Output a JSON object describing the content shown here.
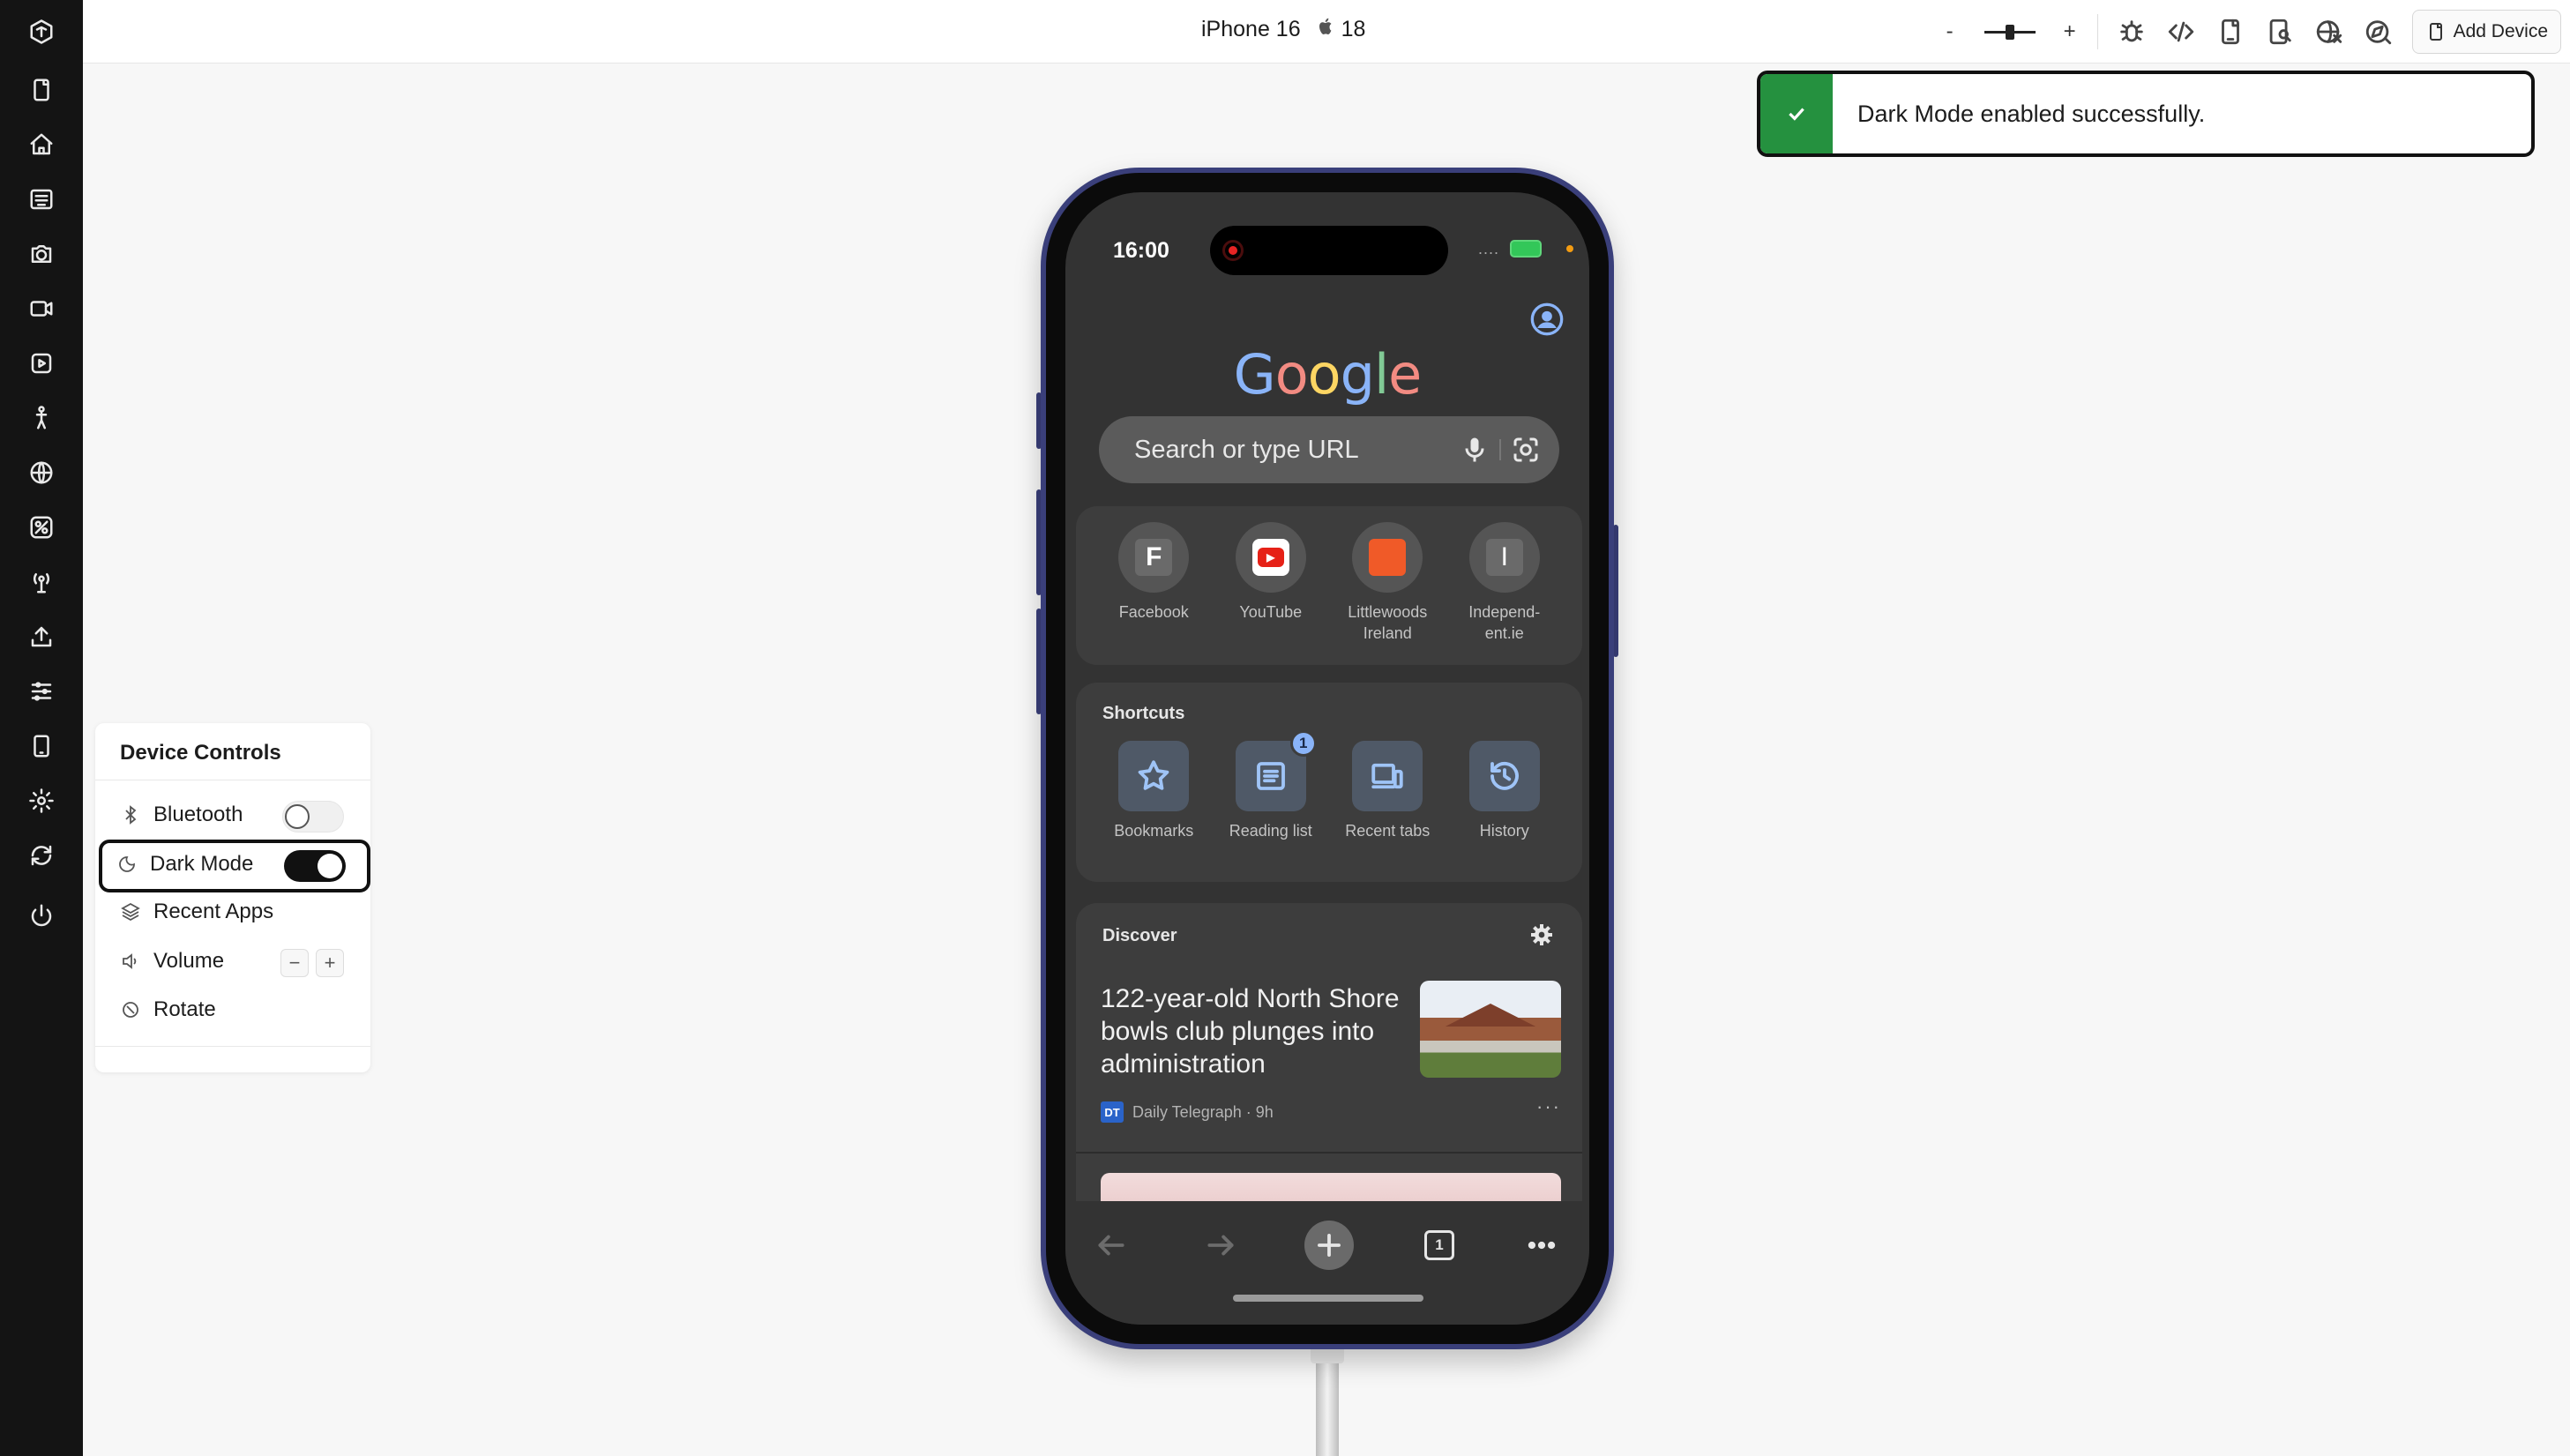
{
  "topbar": {
    "device_name": "iPhone 16",
    "os_version": "18",
    "zoom_minus": "-",
    "zoom_plus": "+",
    "add_device_label": "Add Device"
  },
  "sidebar": {
    "icons": [
      "logo-icon",
      "device-icon",
      "home-icon",
      "app-store-icon",
      "camera-icon",
      "video-icon",
      "media-icon",
      "accessibility-icon",
      "globe-icon",
      "network-icon",
      "antenna-icon",
      "upload-icon",
      "sliders-icon",
      "phone-outline-icon",
      "settings-icon",
      "refresh-icon",
      "power-icon"
    ]
  },
  "toast": {
    "message": "Dark Mode enabled successfully.",
    "accent_color": "#25913f"
  },
  "device_controls": {
    "title": "Device Controls",
    "bluetooth_label": "Bluetooth",
    "bluetooth_on": false,
    "dark_mode_label": "Dark Mode",
    "dark_mode_on": true,
    "recent_apps_label": "Recent Apps",
    "volume_label": "Volume",
    "volume_down": "−",
    "volume_up": "+",
    "rotate_label": "Rotate"
  },
  "phone": {
    "time": "16:00",
    "status_dots": "....",
    "google_letters": [
      "G",
      "o",
      "o",
      "g",
      "l",
      "e"
    ],
    "search_placeholder": "Search or type URL",
    "top_sites": [
      {
        "label": "Facebook",
        "glyph": "F"
      },
      {
        "label": "YouTube",
        "glyph": "▶"
      },
      {
        "label": "Littlewoods Ireland",
        "glyph": ""
      },
      {
        "label": "Independ-ent.ie",
        "glyph": "I"
      }
    ],
    "shortcuts_title": "Shortcuts",
    "shortcuts": [
      {
        "label": "Bookmarks"
      },
      {
        "label": "Reading list",
        "badge": "1"
      },
      {
        "label": "Recent tabs"
      },
      {
        "label": "History"
      }
    ],
    "discover_title": "Discover",
    "news": {
      "title": "122-year-old North Shore bowls club plunges into administration",
      "source_logo": "DT",
      "source": "Daily Telegraph · 9h",
      "more": "···"
    },
    "tab_count": "1"
  }
}
